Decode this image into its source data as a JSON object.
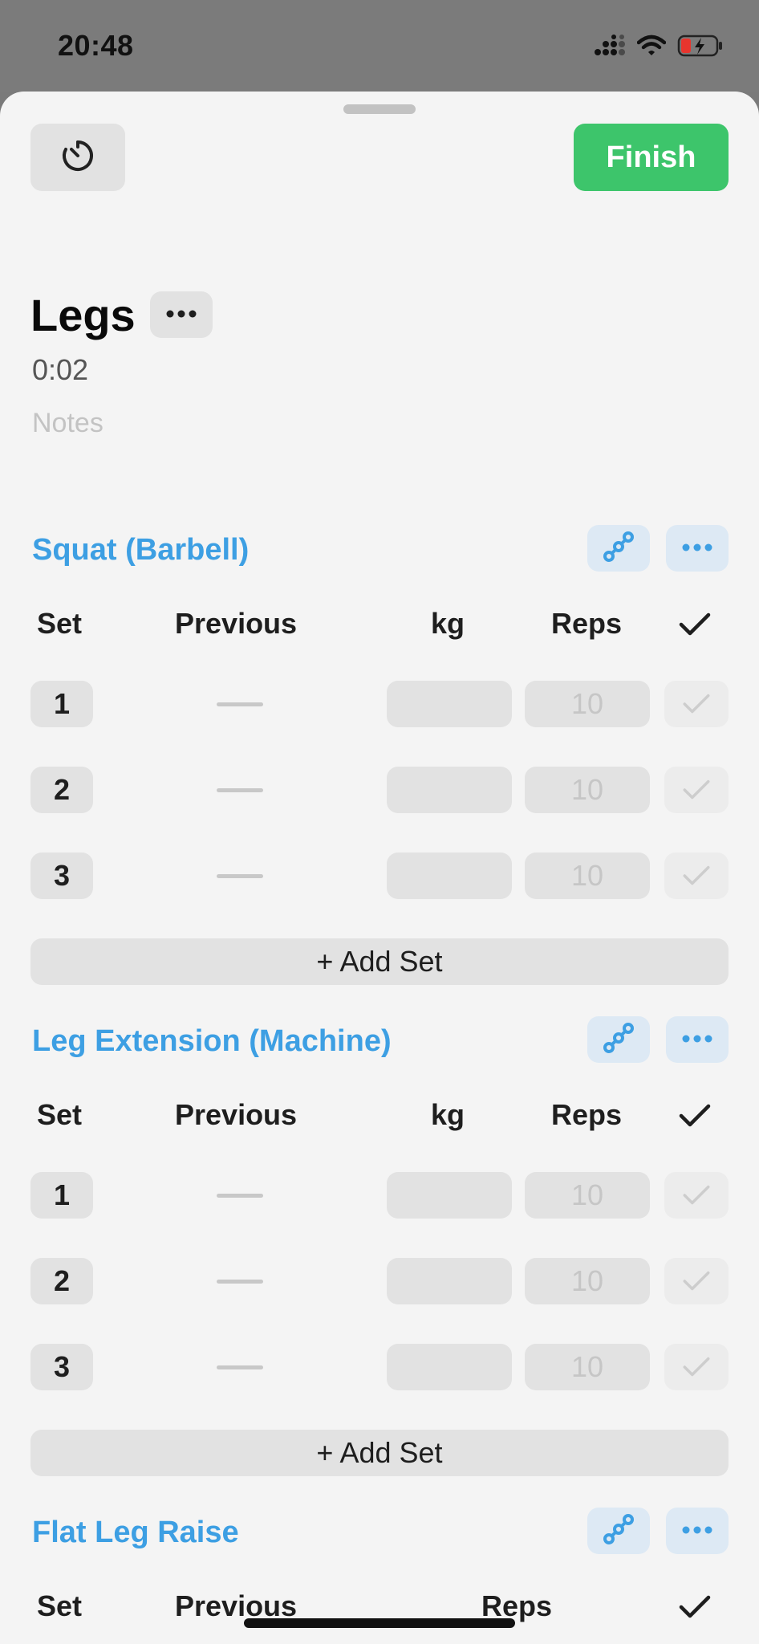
{
  "status_bar": {
    "time": "20:48",
    "icons": [
      "cellular-icon",
      "wifi-icon",
      "battery-charging-icon"
    ]
  },
  "header": {
    "finish_label": "Finish",
    "timer_icon": "stopwatch-icon"
  },
  "workout": {
    "title": "Legs",
    "elapsed": "0:02",
    "notes_placeholder": "Notes"
  },
  "columns": {
    "set": "Set",
    "previous": "Previous",
    "kg": "kg",
    "reps": "Reps"
  },
  "exercises": [
    {
      "name": "Squat (Barbell)",
      "sets": [
        {
          "number": "1",
          "previous": "",
          "kg": "",
          "reps_placeholder": "10"
        },
        {
          "number": "2",
          "previous": "",
          "kg": "",
          "reps_placeholder": "10"
        },
        {
          "number": "3",
          "previous": "",
          "kg": "",
          "reps_placeholder": "10"
        }
      ],
      "add_set_label": "+ Add Set"
    },
    {
      "name": "Leg Extension (Machine)",
      "sets": [
        {
          "number": "1",
          "previous": "",
          "kg": "",
          "reps_placeholder": "10"
        },
        {
          "number": "2",
          "previous": "",
          "kg": "",
          "reps_placeholder": "10"
        },
        {
          "number": "3",
          "previous": "",
          "kg": "",
          "reps_placeholder": "10"
        }
      ],
      "add_set_label": "+ Add Set"
    },
    {
      "name": "Flat Leg Raise",
      "columns": {
        "set": "Set",
        "previous": "Previous",
        "reps": "Reps"
      }
    }
  ],
  "colors": {
    "accent": "#3d9fe3",
    "finish": "#3dc56b"
  }
}
